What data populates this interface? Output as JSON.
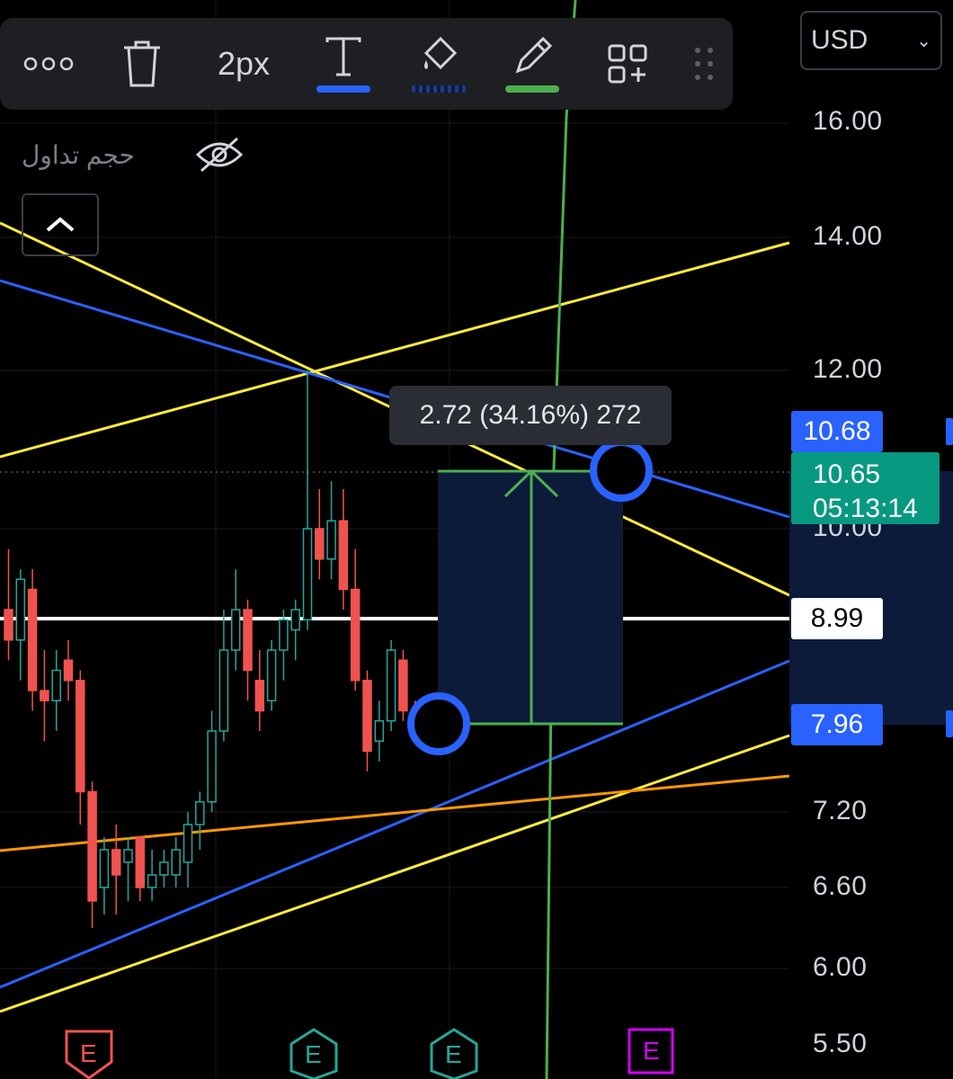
{
  "toolbar": {
    "more_label": "more-options",
    "width_label": "2px",
    "icons": [
      "more-dots-icon",
      "trash-icon",
      "text-icon",
      "fill-bucket-icon",
      "pencil-icon",
      "add-widget-icon",
      "drag-handle-icon"
    ],
    "underline_colors": {
      "text": "#2962ff",
      "fill": "#1e3a8a",
      "pencil": "#4caf50"
    }
  },
  "currency": {
    "selected": "USD"
  },
  "panel": {
    "volume_label": "حجم تداول"
  },
  "price_axis": {
    "ticks": [
      "16.00",
      "14.00",
      "12.00",
      "10.00",
      "7.20",
      "6.60",
      "6.00",
      "5.50"
    ]
  },
  "price_tags": {
    "upper": "10.68",
    "current_price": "10.65",
    "countdown": "05:13:14",
    "line": "8.99",
    "lower": "7.96"
  },
  "measure_tooltip": "2.72 (34.16%) 272",
  "earnings_markers": [
    "E",
    "E",
    "E",
    "E"
  ],
  "colors": {
    "up": "#26a69a",
    "down": "#ef5350",
    "blue_line": "#2962ff",
    "yellow_line": "#ffeb3b",
    "orange_line": "#ff9800",
    "green_line": "#4caf50",
    "current": "#089981",
    "zone": "#0d1b3a"
  },
  "chart_data": {
    "type": "candlestick",
    "candles": [
      {
        "o": 9.2,
        "h": 9.8,
        "l": 8.7,
        "c": 8.9
      },
      {
        "o": 8.9,
        "h": 9.6,
        "l": 8.5,
        "c": 9.5
      },
      {
        "o": 9.4,
        "h": 9.6,
        "l": 8.2,
        "c": 8.4
      },
      {
        "o": 8.4,
        "h": 8.8,
        "l": 7.9,
        "c": 8.3
      },
      {
        "o": 8.3,
        "h": 8.8,
        "l": 8.0,
        "c": 8.6
      },
      {
        "o": 8.7,
        "h": 8.9,
        "l": 8.3,
        "c": 8.5
      },
      {
        "o": 8.5,
        "h": 8.6,
        "l": 7.1,
        "c": 7.4
      },
      {
        "o": 7.4,
        "h": 7.5,
        "l": 6.3,
        "c": 6.5
      },
      {
        "o": 6.6,
        "h": 7.0,
        "l": 6.4,
        "c": 6.9
      },
      {
        "o": 6.9,
        "h": 7.1,
        "l": 6.4,
        "c": 6.7
      },
      {
        "o": 6.8,
        "h": 7.0,
        "l": 6.5,
        "c": 6.9
      },
      {
        "o": 7.0,
        "h": 7.0,
        "l": 6.5,
        "c": 6.6
      },
      {
        "o": 6.6,
        "h": 6.9,
        "l": 6.5,
        "c": 6.7
      },
      {
        "o": 6.7,
        "h": 6.9,
        "l": 6.6,
        "c": 6.8
      },
      {
        "o": 6.7,
        "h": 7.0,
        "l": 6.6,
        "c": 6.9
      },
      {
        "o": 6.8,
        "h": 7.2,
        "l": 6.6,
        "c": 7.1
      },
      {
        "o": 7.1,
        "h": 7.4,
        "l": 6.9,
        "c": 7.3
      },
      {
        "o": 7.3,
        "h": 8.2,
        "l": 7.2,
        "c": 8.0
      },
      {
        "o": 8.0,
        "h": 9.2,
        "l": 7.9,
        "c": 8.8
      },
      {
        "o": 8.8,
        "h": 9.6,
        "l": 8.6,
        "c": 9.2
      },
      {
        "o": 9.2,
        "h": 9.3,
        "l": 8.3,
        "c": 8.6
      },
      {
        "o": 8.5,
        "h": 8.8,
        "l": 8.0,
        "c": 8.2
      },
      {
        "o": 8.3,
        "h": 8.9,
        "l": 8.2,
        "c": 8.8
      },
      {
        "o": 8.8,
        "h": 9.2,
        "l": 8.5,
        "c": 9.1
      },
      {
        "o": 9.0,
        "h": 9.3,
        "l": 8.7,
        "c": 9.2
      },
      {
        "o": 9.1,
        "h": 12.0,
        "l": 9.0,
        "c": 10.0
      },
      {
        "o": 10.0,
        "h": 10.5,
        "l": 9.5,
        "c": 9.7
      },
      {
        "o": 9.7,
        "h": 10.6,
        "l": 9.5,
        "c": 10.1
      },
      {
        "o": 10.1,
        "h": 10.5,
        "l": 9.2,
        "c": 9.4
      },
      {
        "o": 9.4,
        "h": 9.8,
        "l": 8.4,
        "c": 8.5
      },
      {
        "o": 8.5,
        "h": 8.6,
        "l": 7.6,
        "c": 7.8
      },
      {
        "o": 7.9,
        "h": 8.3,
        "l": 7.7,
        "c": 8.1
      },
      {
        "o": 8.1,
        "h": 8.9,
        "l": 8.0,
        "c": 8.8
      },
      {
        "o": 8.7,
        "h": 8.8,
        "l": 8.1,
        "c": 8.2
      },
      {
        "o": 8.2,
        "h": 8.3,
        "l": 8.0,
        "c": 8.1
      }
    ],
    "y_axis_ticks": [
      16.0,
      14.0,
      12.0,
      10.0,
      7.2,
      6.6,
      6.0,
      5.5
    ],
    "measure": {
      "from": 7.96,
      "to": 10.68,
      "change": 2.72,
      "percent": 34.16,
      "ticks": 272
    },
    "horizontal_line": 8.99,
    "current_price": 10.65
  }
}
